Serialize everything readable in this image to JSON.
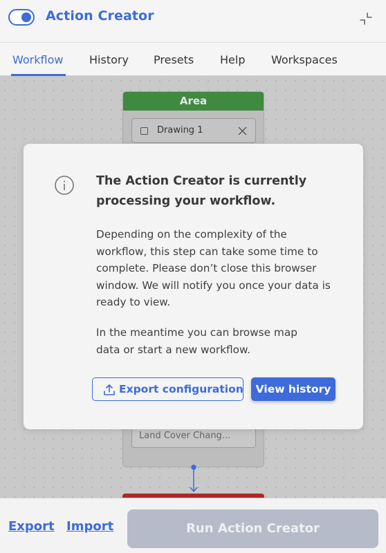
{
  "header": {
    "title": "Action Creator",
    "toggle_on": true
  },
  "tabs": [
    {
      "label": "Workflow",
      "active": true
    },
    {
      "label": "History",
      "active": false
    },
    {
      "label": "Presets",
      "active": false
    },
    {
      "label": "Help",
      "active": false
    },
    {
      "label": "Workspaces",
      "active": false
    }
  ],
  "canvas": {
    "area_node": {
      "title": "Area",
      "item_label": "Drawing 1"
    },
    "landcover_node": {
      "value": "Land Cover Chang..."
    }
  },
  "modal": {
    "title": "The Action Creator is currently processing your workflow.",
    "body": "Depending on the complexity of the workflow, this step can take some time to complete. Please don’t close this browser window. We will notify you once your data is ready to view.",
    "body2": "In the meantime you can browse map data or start a new workflow.",
    "export_button": "Export configuration",
    "history_button": "View history"
  },
  "footer": {
    "export_link": "Export",
    "import_link": "Import",
    "run_button": "Run Action Creator"
  },
  "colors": {
    "accent": "#3d6bd9",
    "area_header": "#3f8a3f",
    "error_node": "#b02626",
    "run_disabled": "#b6bbc9"
  },
  "icons": [
    "toggle-switch",
    "collapse-icon",
    "checkbox",
    "close-icon",
    "info-icon",
    "upload-icon"
  ]
}
